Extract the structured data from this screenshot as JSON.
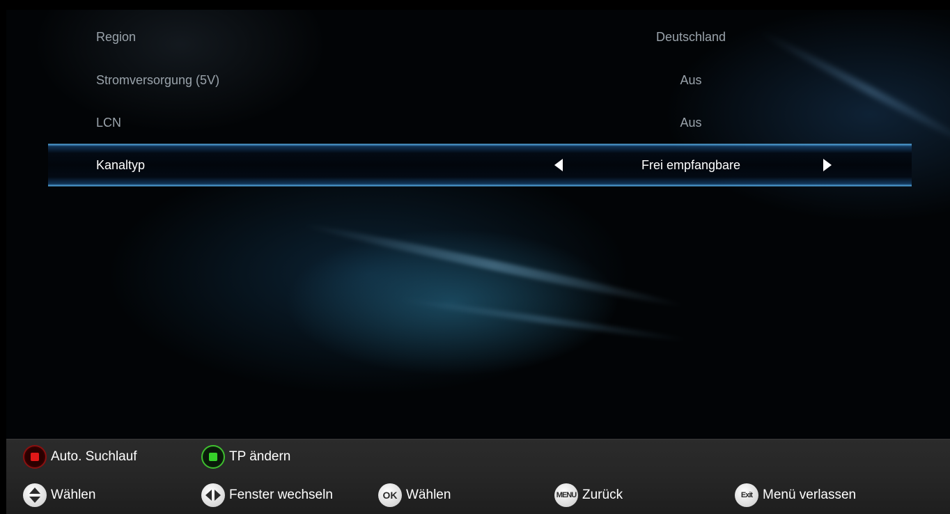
{
  "settings": {
    "rows": [
      {
        "label": "Region",
        "value": "Deutschland"
      },
      {
        "label": "Stromversorgung (5V)",
        "value": "Aus"
      },
      {
        "label": "LCN",
        "value": "Aus"
      },
      {
        "label": "Kanaltyp",
        "value": "Frei empfangbare",
        "selected": true
      }
    ]
  },
  "footer": {
    "row1": [
      {
        "key": "red",
        "icon": "red-key-icon",
        "label": "Auto. Suchlauf"
      },
      {
        "key": "green",
        "icon": "green-key-icon",
        "label": "TP ändern"
      }
    ],
    "row2": [
      {
        "key_text": "",
        "icon": "up-down-icon",
        "label": "Wählen"
      },
      {
        "key_text": "",
        "icon": "left-right-icon",
        "label": "Fenster wechseln"
      },
      {
        "key_text": "OK",
        "icon": "ok-key-icon",
        "label": "Wählen"
      },
      {
        "key_text": "MENU",
        "icon": "menu-key-icon",
        "label": "Zurück"
      },
      {
        "key_text": "Exit",
        "icon": "exit-key-icon",
        "label": "Menü verlassen"
      }
    ]
  },
  "colors": {
    "highlight": "#5ab4f0",
    "red_key": "#e01818",
    "green_key": "#36d22a"
  }
}
